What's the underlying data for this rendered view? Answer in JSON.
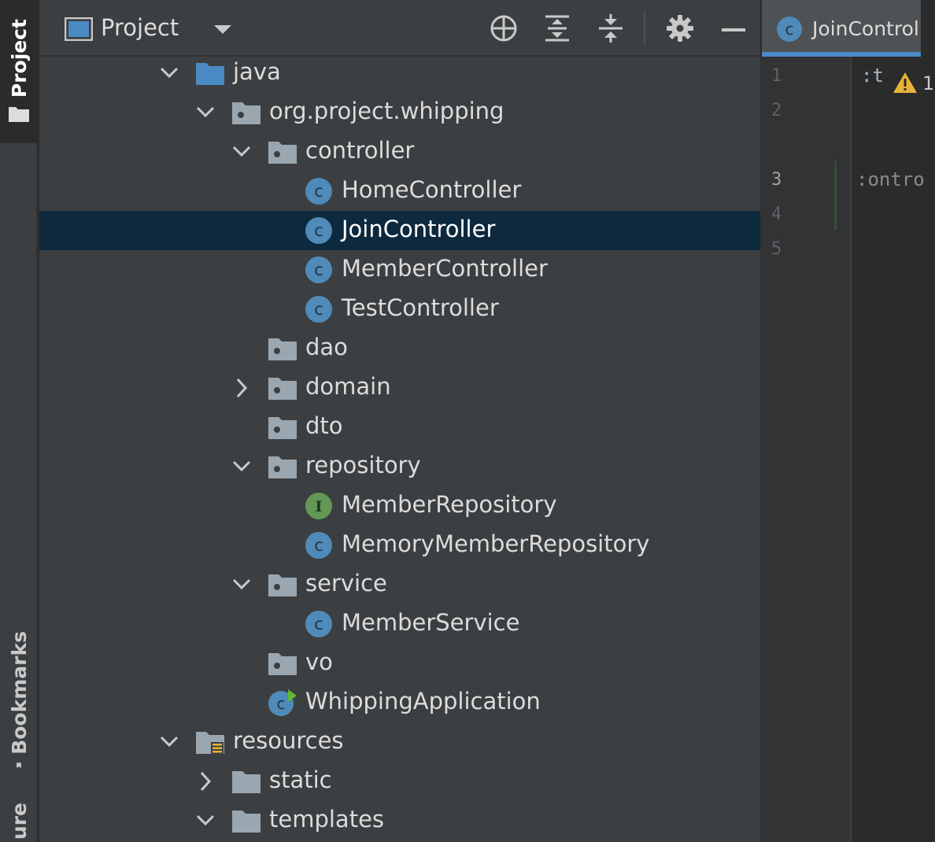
{
  "left_strip": {
    "project_tab": "Project",
    "bookmarks_tab": "Bookmarks",
    "structure_tab": "ure"
  },
  "project_panel": {
    "title": "Project",
    "view_mode_icon": "project-view-icon",
    "dropdown_icon": "caret-down-icon",
    "toolbar_icons": [
      "locate-target-icon",
      "expand-all-icon",
      "collapse-all-icon",
      "gear-icon",
      "minimize-icon"
    ]
  },
  "tree": {
    "rows": [
      {
        "label": "java",
        "icon": "source-folder-icon",
        "chevron": "down"
      },
      {
        "label": "org.project.whipping",
        "icon": "package-icon",
        "chevron": "down"
      },
      {
        "label": "controller",
        "icon": "package-icon",
        "chevron": "down"
      },
      {
        "label": "HomeController",
        "icon": "class-icon",
        "chevron": "none"
      },
      {
        "label": "JoinController",
        "icon": "class-icon",
        "chevron": "none",
        "selected": true
      },
      {
        "label": "MemberController",
        "icon": "class-icon",
        "chevron": "none"
      },
      {
        "label": "TestController",
        "icon": "class-icon",
        "chevron": "none"
      },
      {
        "label": "dao",
        "icon": "package-icon",
        "chevron": "none"
      },
      {
        "label": "domain",
        "icon": "package-icon",
        "chevron": "right"
      },
      {
        "label": "dto",
        "icon": "package-icon",
        "chevron": "none"
      },
      {
        "label": "repository",
        "icon": "package-icon",
        "chevron": "down"
      },
      {
        "label": "MemberRepository",
        "icon": "interface-icon",
        "chevron": "none"
      },
      {
        "label": "MemoryMemberRepository",
        "icon": "class-icon",
        "chevron": "none"
      },
      {
        "label": "service",
        "icon": "package-icon",
        "chevron": "down"
      },
      {
        "label": "MemberService",
        "icon": "class-icon",
        "chevron": "none"
      },
      {
        "label": "vo",
        "icon": "package-icon",
        "chevron": "none"
      },
      {
        "label": "WhippingApplication",
        "icon": "spring-boot-class-icon",
        "chevron": "none"
      },
      {
        "label": "resources",
        "icon": "resources-folder-icon",
        "chevron": "down"
      },
      {
        "label": "static",
        "icon": "folder-icon",
        "chevron": "right"
      },
      {
        "label": "templates",
        "icon": "folder-icon",
        "chevron": "down"
      }
    ]
  },
  "editor": {
    "tab_label": "JoinControl",
    "line_numbers": [
      "1",
      "2",
      "3",
      "4",
      "5"
    ],
    "code_line_1": ":t",
    "code_line_3": ":ontro",
    "warning_count": "1",
    "colors": {
      "accent": "#4a88c7",
      "selection": "#0d293e",
      "class_icon": "#4f8ab9",
      "interface_icon": "#629755",
      "warning": "#e8b339"
    }
  }
}
